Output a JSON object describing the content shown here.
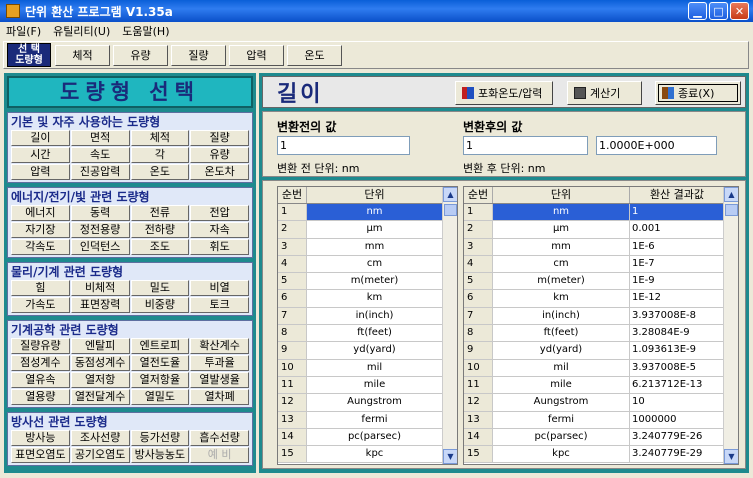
{
  "window": {
    "title": "단위 환산 프로그램 V1.35a"
  },
  "menu": [
    "파일(F)",
    "유틸리티(U)",
    "도움말(H)"
  ],
  "toolbar": {
    "label": "선 택\n도량형",
    "buttons": [
      "체적",
      "유량",
      "질량",
      "압력",
      "온도"
    ]
  },
  "left": {
    "title": "도량형 선택",
    "groups": [
      {
        "title": "기본 및 자주 사용하는 도량형",
        "items": [
          "길이",
          "면적",
          "체적",
          "질량",
          "시간",
          "속도",
          "각",
          "유량",
          "압력",
          "진공압력",
          "온도",
          "온도차"
        ]
      },
      {
        "title": "에너지/전기/빛 관련 도량형",
        "items": [
          "에너지",
          "동력",
          "전류",
          "전압",
          "자기장",
          "정전용량",
          "전하량",
          "자속",
          "각속도",
          "인덕턴스",
          "조도",
          "휘도"
        ]
      },
      {
        "title": "물리/기계 관련 도량형",
        "items": [
          "힘",
          "비체적",
          "밀도",
          "비열",
          "가속도",
          "표면장력",
          "비중량",
          "토크"
        ]
      },
      {
        "title": "기계공학 관련 도량형",
        "items": [
          "질량유량",
          "엔탈피",
          "엔트로피",
          "확산계수",
          "점성계수",
          "동점성계수",
          "열전도율",
          "투과율",
          "열유속",
          "열저항",
          "열저항율",
          "열발생율",
          "열용량",
          "열전달계수",
          "열밀도",
          "열차폐"
        ]
      },
      {
        "title": "방사선 관련 도량형",
        "items": [
          "방사능",
          "조사선량",
          "등가선량",
          "흡수선량",
          "표면오염도",
          "공기오염도",
          "방사능농도",
          "예 비"
        ]
      }
    ]
  },
  "right": {
    "title": "길이",
    "buttons": {
      "saturation": "포화온도/압력",
      "calculator": "계산기",
      "exit": "종료(X)"
    },
    "before_label": "변환전의 값",
    "after_label": "변환후의 값",
    "before_value": "1",
    "after_value": "1",
    "result_value": "1.0000E+000",
    "before_unit": "변환 전 단위: nm",
    "after_unit": "변환 후 단위: nm",
    "left_table": {
      "headers": [
        "순번",
        "단위"
      ],
      "rows": [
        [
          "1",
          "nm"
        ],
        [
          "2",
          "μm"
        ],
        [
          "3",
          "mm"
        ],
        [
          "4",
          "cm"
        ],
        [
          "5",
          "m(meter)"
        ],
        [
          "6",
          "km"
        ],
        [
          "7",
          "in(inch)"
        ],
        [
          "8",
          "ft(feet)"
        ],
        [
          "9",
          "yd(yard)"
        ],
        [
          "10",
          "mil"
        ],
        [
          "11",
          "mile"
        ],
        [
          "12",
          "Aungstrom"
        ],
        [
          "13",
          "fermi"
        ],
        [
          "14",
          "pc(parsec)"
        ],
        [
          "15",
          "kpc"
        ]
      ]
    },
    "right_table": {
      "headers": [
        "순번",
        "단위",
        "환산 결과값"
      ],
      "rows": [
        [
          "1",
          "nm",
          "1"
        ],
        [
          "2",
          "μm",
          "0.001"
        ],
        [
          "3",
          "mm",
          "1E-6"
        ],
        [
          "4",
          "cm",
          "1E-7"
        ],
        [
          "5",
          "m(meter)",
          "1E-9"
        ],
        [
          "6",
          "km",
          "1E-12"
        ],
        [
          "7",
          "in(inch)",
          "3.937008E-8"
        ],
        [
          "8",
          "ft(feet)",
          "3.28084E-9"
        ],
        [
          "9",
          "yd(yard)",
          "1.093613E-9"
        ],
        [
          "10",
          "mil",
          "3.937008E-5"
        ],
        [
          "11",
          "mile",
          "6.213712E-13"
        ],
        [
          "12",
          "Aungstrom",
          "10"
        ],
        [
          "13",
          "fermi",
          "1000000"
        ],
        [
          "14",
          "pc(parsec)",
          "3.240779E-26"
        ],
        [
          "15",
          "kpc",
          "3.240779E-29"
        ]
      ]
    }
  }
}
